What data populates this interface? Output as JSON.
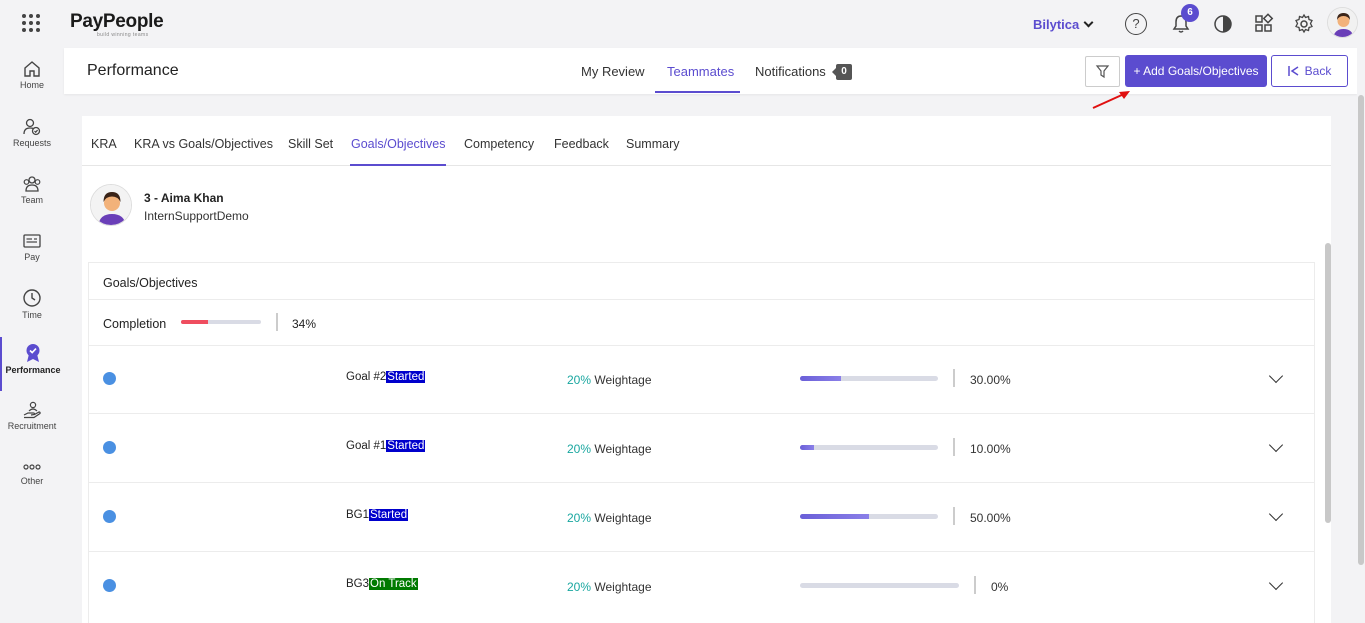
{
  "app": {
    "brand": "PayPeople",
    "tagline": "build winning teams",
    "company": "Bilytica",
    "notification_count": "6"
  },
  "sidebar": {
    "items": [
      {
        "label": "Home",
        "icon": "home-icon"
      },
      {
        "label": "Requests",
        "icon": "requests-icon"
      },
      {
        "label": "Team",
        "icon": "team-icon"
      },
      {
        "label": "Pay",
        "icon": "pay-icon"
      },
      {
        "label": "Time",
        "icon": "clock-icon"
      },
      {
        "label": "Performance",
        "icon": "award-icon",
        "active": true
      },
      {
        "label": "Recruitment",
        "icon": "recruitment-icon"
      },
      {
        "label": "Other",
        "icon": "more-icon"
      }
    ]
  },
  "header": {
    "title": "Performance",
    "tabs": [
      {
        "label": "My Review"
      },
      {
        "label": "Teammates",
        "active": true
      },
      {
        "label": "Notifications",
        "count": "0"
      }
    ],
    "add_button": "+ Add Goals/Objectives",
    "back_button": "Back"
  },
  "subtabs": [
    {
      "label": "KRA"
    },
    {
      "label": "KRA vs Goals/Objectives"
    },
    {
      "label": "Skill Set"
    },
    {
      "label": "Goals/Objectives",
      "active": true
    },
    {
      "label": "Competency"
    },
    {
      "label": "Feedback"
    },
    {
      "label": "Summary"
    }
  ],
  "employee": {
    "name": "3 - Aima Khan",
    "department": "InternSupportDemo"
  },
  "goals": {
    "title": "Goals/Objectives",
    "completion_label": "Completion",
    "completion_value": 34,
    "completion_text": "34%",
    "items": [
      {
        "name": "Goal #2",
        "status": "Started",
        "status_color": "#0000cc",
        "weight": "20%",
        "weight_label": "Weightage",
        "progress": 30,
        "progress_text": "30.00%"
      },
      {
        "name": "Goal #1",
        "status": "Started",
        "status_color": "#0000cc",
        "weight": "20%",
        "weight_label": "Weightage",
        "progress": 10,
        "progress_text": "10.00%"
      },
      {
        "name": "BG1",
        "status": "Started",
        "status_color": "#0000cc",
        "weight": "20%",
        "weight_label": "Weightage",
        "progress": 50,
        "progress_text": "50.00%"
      },
      {
        "name": "BG3",
        "status": "On Track",
        "status_color": "#007a00",
        "weight": "20%",
        "weight_label": "Weightage",
        "progress": 0,
        "progress_text": "0%"
      }
    ]
  },
  "colors": {
    "accent": "#5b4ccf",
    "completion_bar": "#ef4d5f",
    "weight_pct": "#1aa7a0",
    "dot": "#4a90e2"
  }
}
